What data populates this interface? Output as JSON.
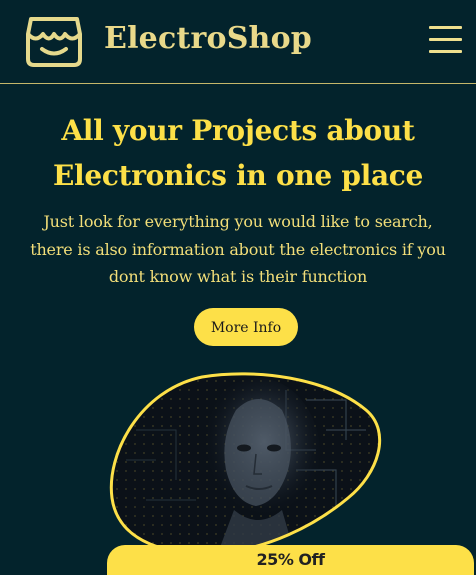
{
  "header": {
    "logo_icon": "storefront-icon",
    "brand": "ElectroShop",
    "menu_icon": "hamburger-menu-icon"
  },
  "hero": {
    "title_lines": [
      "All your Projects about",
      "Electronics in one place"
    ],
    "description_lines": [
      "Just look for everything you would like to search,",
      "there is also information about the electronics if you",
      "dont know what is their function"
    ],
    "button_label": "More Info",
    "image": "robot-face-circuit-image"
  },
  "badge": {
    "text": "25% Off"
  },
  "colors": {
    "background": "#03232c",
    "accent": "#fde048",
    "text": "#efe08e"
  }
}
